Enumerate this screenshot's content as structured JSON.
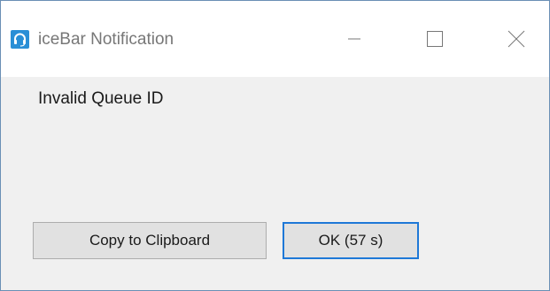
{
  "window": {
    "title": "iceBar Notification",
    "app_icon": "headset-icon",
    "controls": {
      "minimize": "minimize-icon",
      "maximize": "maximize-icon",
      "close": "close-icon"
    }
  },
  "dialog": {
    "message": "Invalid Queue ID",
    "copy_button_label": "Copy to Clipboard",
    "ok_button_label": "OK (57 s)"
  },
  "colors": {
    "accent": "#1e78d7",
    "app_icon_bg": "#2a8fd6",
    "window_border": "#6a8fb5",
    "dialog_bg": "#f0f0f0"
  }
}
